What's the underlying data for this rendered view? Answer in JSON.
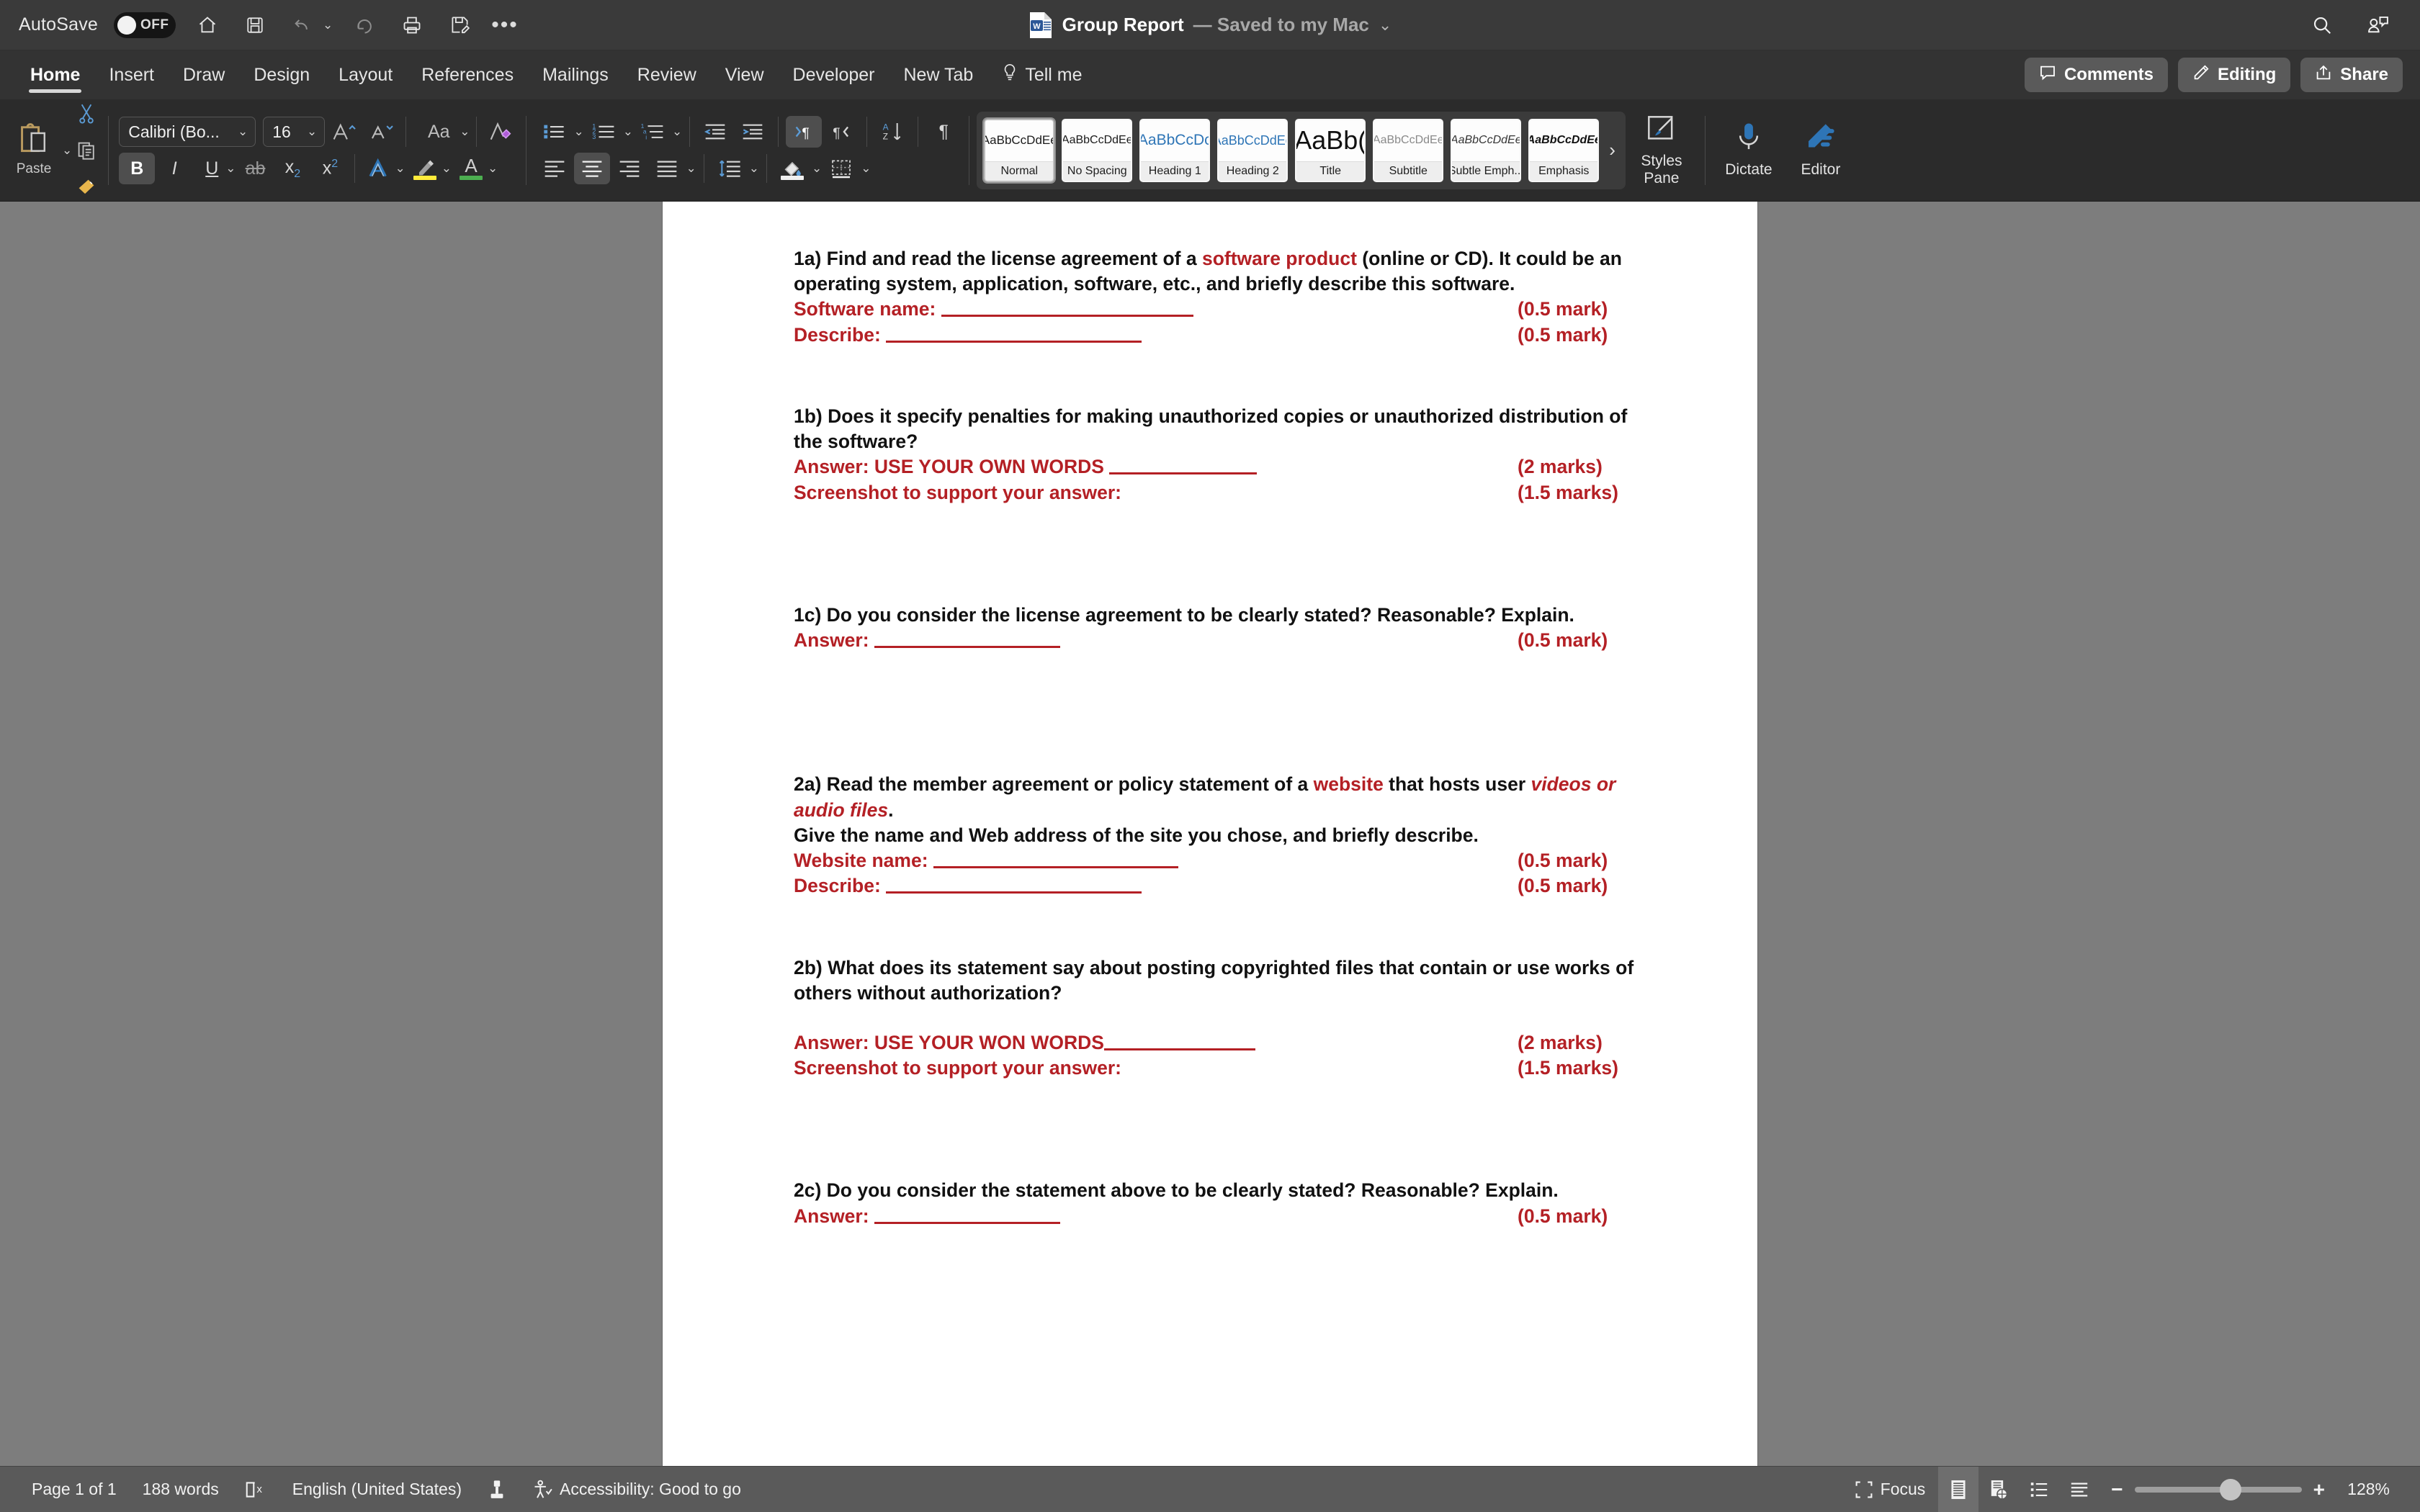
{
  "titlebar": {
    "autosave_label": "AutoSave",
    "autosave_state": "OFF",
    "doc_name": "Group Report",
    "doc_saved_status": "— Saved to my Mac",
    "quick_access": [
      "home-icon",
      "save-icon",
      "undo-icon",
      "redo-icon",
      "print-icon",
      "save-as-icon",
      "more-commands-icon"
    ],
    "right_icons": [
      "search-icon",
      "collaborator-icon"
    ]
  },
  "ribbon_tabs": {
    "tabs": [
      {
        "label": "Home",
        "active": true
      },
      {
        "label": "Insert",
        "active": false
      },
      {
        "label": "Draw",
        "active": false
      },
      {
        "label": "Design",
        "active": false
      },
      {
        "label": "Layout",
        "active": false
      },
      {
        "label": "References",
        "active": false
      },
      {
        "label": "Mailings",
        "active": false
      },
      {
        "label": "Review",
        "active": false
      },
      {
        "label": "View",
        "active": false
      },
      {
        "label": "Developer",
        "active": false
      },
      {
        "label": "New Tab",
        "active": false
      },
      {
        "label": "Tell me",
        "active": false
      }
    ],
    "comments_label": "Comments",
    "editing_label": "Editing",
    "share_label": "Share"
  },
  "ribbon": {
    "paste_label": "Paste",
    "font_name": "Calibri (Bo...",
    "font_size": "16",
    "styles": [
      {
        "preview": "AaBbCcDdEe",
        "name": "Normal",
        "selected": true,
        "style": "normal"
      },
      {
        "preview": "AaBbCcDdEe",
        "name": "No Spacing",
        "selected": false,
        "style": "normal"
      },
      {
        "preview": "AaBbCcDc",
        "name": "Heading 1",
        "selected": false,
        "style": "h1"
      },
      {
        "preview": "AaBbCcDdEe",
        "name": "Heading 2",
        "selected": false,
        "style": "h2"
      },
      {
        "preview": "AaBb(",
        "name": "Title",
        "selected": false,
        "style": "title"
      },
      {
        "preview": "AaBbCcDdEe",
        "name": "Subtitle",
        "selected": false,
        "style": "subtitle"
      },
      {
        "preview": "AaBbCcDdEe",
        "name": "Subtle Emph...",
        "selected": false,
        "style": "subtle-emph"
      },
      {
        "preview": "AaBbCcDdEe",
        "name": "Emphasis",
        "selected": false,
        "style": "emphasis"
      }
    ],
    "gallery_next": "›",
    "styles_pane_label": "Styles Pane",
    "dictate_label": "Dictate",
    "editor_label": "Editor"
  },
  "document": {
    "q1a_line1_a": "1a) Find and read the license agreement of a ",
    "q1a_line1_red": "software product",
    "q1a_line1_b": " (online or CD). It could be an",
    "q1a_line2": "operating system, application, software, etc., and briefly describe this software.",
    "q1a_sw_name": "Software name: ",
    "q1a_sw_mark": "(0.5 mark)",
    "q1a_desc": "Describe: ",
    "q1a_desc_mark": "(0.5 mark)",
    "q1b_line1": "1b) Does it specify penalties for making unauthorized copies or unauthorized distribution of",
    "q1b_line2": "the software?",
    "q1b_answer": "Answer: USE YOUR OWN WORDS ",
    "q1b_answer_mark": "(2 marks)",
    "q1b_screenshot": "Screenshot to support your answer:",
    "q1b_screenshot_mark": "(1.5 marks)",
    "q1c_line1": "1c) Do you consider the license agreement to be clearly stated? Reasonable? Explain.",
    "q1c_answer": "Answer: ",
    "q1c_answer_mark": "(0.5 mark)",
    "q2a_line1_a": "2a) Read the member agreement or policy statement of a ",
    "q2a_line1_red": "website",
    "q2a_line1_b": " that hosts user ",
    "q2a_line1_ital": "videos or",
    "q2a_line2_ital": "audio files",
    "q2a_line2_b": ".",
    "q2a_line3": "Give the name and Web address of the site you chose, and briefly describe.",
    "q2a_web_name": "Website name: ",
    "q2a_web_mark": "(0.5 mark)",
    "q2a_desc": "Describe: ",
    "q2a_desc_mark": "(0.5 mark)",
    "q2b_line1": "2b) What does its statement say about posting copyrighted files that contain or use works of",
    "q2b_line2": "others without authorization?",
    "q2b_answer": "Answer: USE YOUR WON WORDS",
    "q2b_answer_mark": "(2 marks)",
    "q2b_screenshot": "Screenshot to support your answer:",
    "q2b_screenshot_mark": "(1.5 marks)",
    "q2c_line1": "2c) Do you consider the statement above to be clearly stated? Reasonable? Explain.",
    "q2c_answer": "Answer: ",
    "q2c_answer_mark": "(0.5 mark)"
  },
  "status": {
    "page_label": "Page 1 of 1",
    "word_count": "188 words",
    "language": "English (United States)",
    "accessibility": "Accessibility: Good to go",
    "focus_label": "Focus",
    "zoom_level": "128%",
    "zoom_out": "−",
    "zoom_in": "+"
  },
  "colors": {
    "accent_red": "#b42025",
    "ribbon_bg": "#2b2b2b",
    "titlebar_bg": "#3a3a3a",
    "status_bg": "#5a5a5a",
    "page_bg": "#7d7d7d"
  }
}
